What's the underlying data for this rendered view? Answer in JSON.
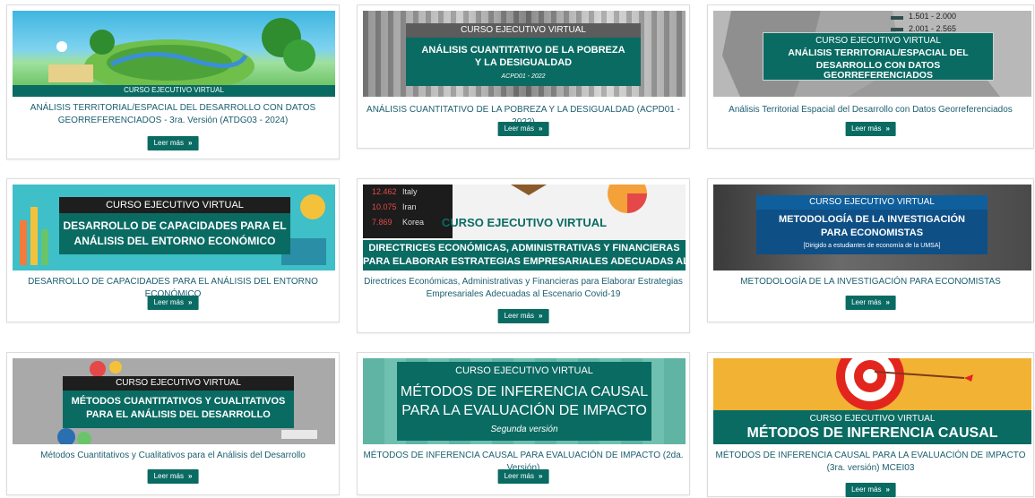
{
  "colors": {
    "teal": "#0a6b63",
    "caption": "#1b5e6f",
    "button": "#0a6b63"
  },
  "button_label": "Leer más",
  "button_icon": "double-chevron-right-icon",
  "cards": [
    {
      "caption": "ANÁLISIS TERRITORIAL/ESPACIAL DEL DESARROLLO CON DATOS GEORREFERENCIADOS - 3ra. Versión (ATDG03 - 2024)",
      "overlay": {
        "label": "CURSO EJECUTIVO VIRTUAL"
      }
    },
    {
      "caption": "ANÁLISIS CUANTITATIVO DE LA POBREZA Y LA DESIGUALDAD (ACPD01 - 2022)",
      "overlay": {
        "label": "CURSO EJECUTIVO VIRTUAL",
        "title1": "ANÁLISIS CUANTITATIVO DE LA POBREZA",
        "title2": "Y LA DESIGUALDAD",
        "code": "ACPD01 - 2022"
      }
    },
    {
      "caption": "Análisis Territorial Espacial del Desarrollo con Datos Georreferenciados",
      "overlay": {
        "label": "CURSO EJECUTIVO VIRTUAL",
        "title1": "ANÁLISIS TERRITORIAL/ESPACIAL DEL",
        "title2": "DESARROLLO CON DATOS GEORREFERENCIADOS",
        "legend1": "1.501 - 2.000",
        "legend2": "2.001 - 2.565"
      }
    },
    {
      "caption": "DESARROLLO DE CAPACIDADES PARA EL ANÁLISIS DEL ENTORNO ECONÓMICO",
      "overlay": {
        "label": "CURSO EJECUTIVO VIRTUAL",
        "title1": "DESARROLLO DE CAPACIDADES PARA EL",
        "title2": "ANÁLISIS DEL ENTORNO ECONÓMICO"
      }
    },
    {
      "caption": "Directrices Económicas, Administrativas y Financieras para Elaborar Estrategias Empresariales Adecuadas al Escenario Covid-19",
      "overlay": {
        "label": "CURSO EJECUTIVO VIRTUAL",
        "title1": "DIRECTRICES ECONÓMICAS, ADMINISTRATIVAS Y FINANCIERAS",
        "title2": "PARA ELABORAR ESTRATEGIAS EMPRESARIALES ADECUADAS AL",
        "ticker1_num": "12.462",
        "ticker1_name": "Italy",
        "ticker2_num": "10.075",
        "ticker2_name": "Iran",
        "ticker3_num": "7.869",
        "ticker3_name": "Korea"
      }
    },
    {
      "caption": "METODOLOGÍA DE LA INVESTIGACIÓN PARA ECONOMISTAS",
      "overlay": {
        "label": "CURSO EJECUTIVO VIRTUAL",
        "title1": "METODOLOGÍA DE LA INVESTIGACIÓN",
        "title2": "PARA ECONOMISTAS",
        "sub": "[Dirigido a estudiantes de economía de la UMSA]"
      }
    },
    {
      "caption": "Métodos Cuantitativos y Cualitativos para el Análisis del Desarrollo",
      "overlay": {
        "label": "CURSO EJECUTIVO VIRTUAL",
        "title1": "MÉTODOS CUANTITATIVOS Y CUALITATIVOS",
        "title2": "PARA EL ANÁLISIS DEL DESARROLLO"
      }
    },
    {
      "caption": "MÉTODOS DE INFERENCIA CAUSAL PARA EVALUACIÓN DE IMPACTO (2da. Versión)",
      "overlay": {
        "label": "CURSO EJECUTIVO VIRTUAL",
        "title1": "MÉTODOS DE INFERENCIA CAUSAL",
        "title2": "PARA LA EVALUACIÓN DE IMPACTO",
        "sub": "Segunda versión"
      }
    },
    {
      "caption": "MÉTODOS DE INFERENCIA CAUSAL PARA LA EVALUACIÓN DE IMPACTO (3ra. versión) MCEI03",
      "overlay": {
        "label": "CURSO EJECUTIVO VIRTUAL",
        "title1": "MÉTODOS DE INFERENCIA CAUSAL"
      }
    }
  ]
}
